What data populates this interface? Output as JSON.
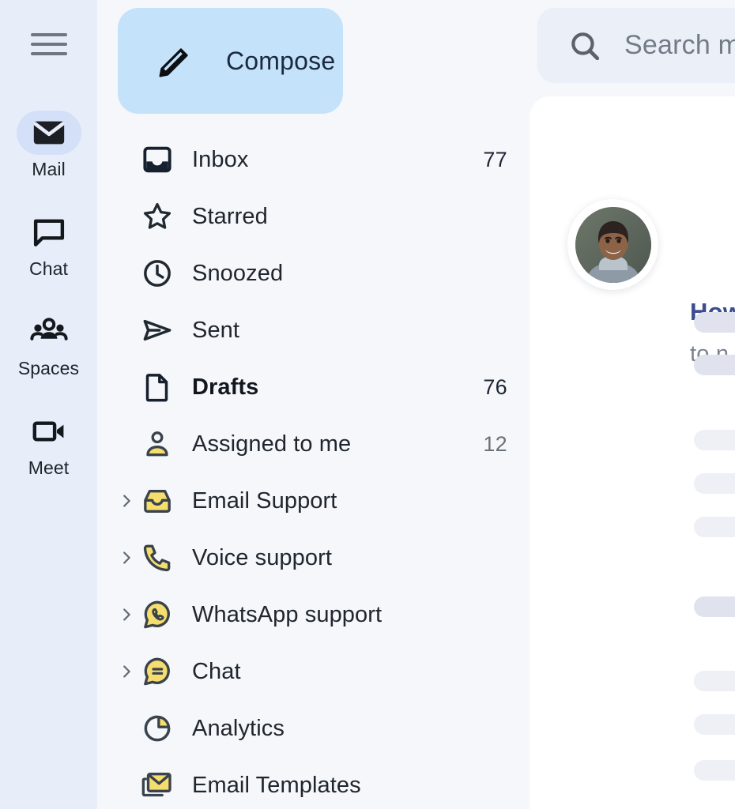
{
  "rail": {
    "menu_icon": "hamburger-menu-icon",
    "items": [
      {
        "label": "Mail",
        "icon": "mail-icon",
        "active": true
      },
      {
        "label": "Chat",
        "icon": "chat-icon",
        "active": false
      },
      {
        "label": "Spaces",
        "icon": "spaces-icon",
        "active": false
      },
      {
        "label": "Meet",
        "icon": "meet-icon",
        "active": false
      }
    ]
  },
  "compose": {
    "label": "Compose",
    "icon": "pencil-icon"
  },
  "folders": [
    {
      "label": "Inbox",
      "icon": "inbox-filled-icon",
      "count": "77",
      "count_dark": true,
      "bold": false,
      "chevron": false
    },
    {
      "label": "Starred",
      "icon": "star-icon",
      "count": "",
      "count_dark": false,
      "bold": false,
      "chevron": false
    },
    {
      "label": "Snoozed",
      "icon": "clock-icon",
      "count": "",
      "count_dark": false,
      "bold": false,
      "chevron": false
    },
    {
      "label": "Sent",
      "icon": "send-icon",
      "count": "",
      "count_dark": false,
      "bold": false,
      "chevron": false
    },
    {
      "label": "Drafts",
      "icon": "document-icon",
      "count": "76",
      "count_dark": false,
      "bold": true,
      "chevron": false
    },
    {
      "label": "Assigned to me",
      "icon": "person-icon",
      "count": "12",
      "count_dark": false,
      "bold": false,
      "chevron": false
    },
    {
      "label": "Email Support",
      "icon": "inbox-tray-icon",
      "count": "",
      "count_dark": false,
      "bold": false,
      "chevron": true
    },
    {
      "label": "Voice support",
      "icon": "phone-icon",
      "count": "",
      "count_dark": false,
      "bold": false,
      "chevron": true
    },
    {
      "label": "WhatsApp support",
      "icon": "whatsapp-icon",
      "count": "",
      "count_dark": false,
      "bold": false,
      "chevron": true
    },
    {
      "label": "Chat",
      "icon": "chat-bubble-icon",
      "count": "",
      "count_dark": false,
      "bold": false,
      "chevron": true
    },
    {
      "label": "Analytics",
      "icon": "pie-chart-icon",
      "count": "",
      "count_dark": false,
      "bold": false,
      "chevron": false
    },
    {
      "label": "Email Templates",
      "icon": "email-stack-icon",
      "count": "",
      "count_dark": false,
      "bold": false,
      "chevron": false
    }
  ],
  "search": {
    "icon": "search-icon",
    "placeholder": "Search m"
  },
  "message": {
    "avatar": "user-avatar",
    "title": "How",
    "subtitle": "to n"
  },
  "colors": {
    "rail_bg": "#e7eefa",
    "panel_bg": "#f5f7fb",
    "compose_bg": "#c5e2fb",
    "accent_yellow": "#f5de6e",
    "icon_dark": "#37414e",
    "title_blue": "#3c4c8e"
  }
}
